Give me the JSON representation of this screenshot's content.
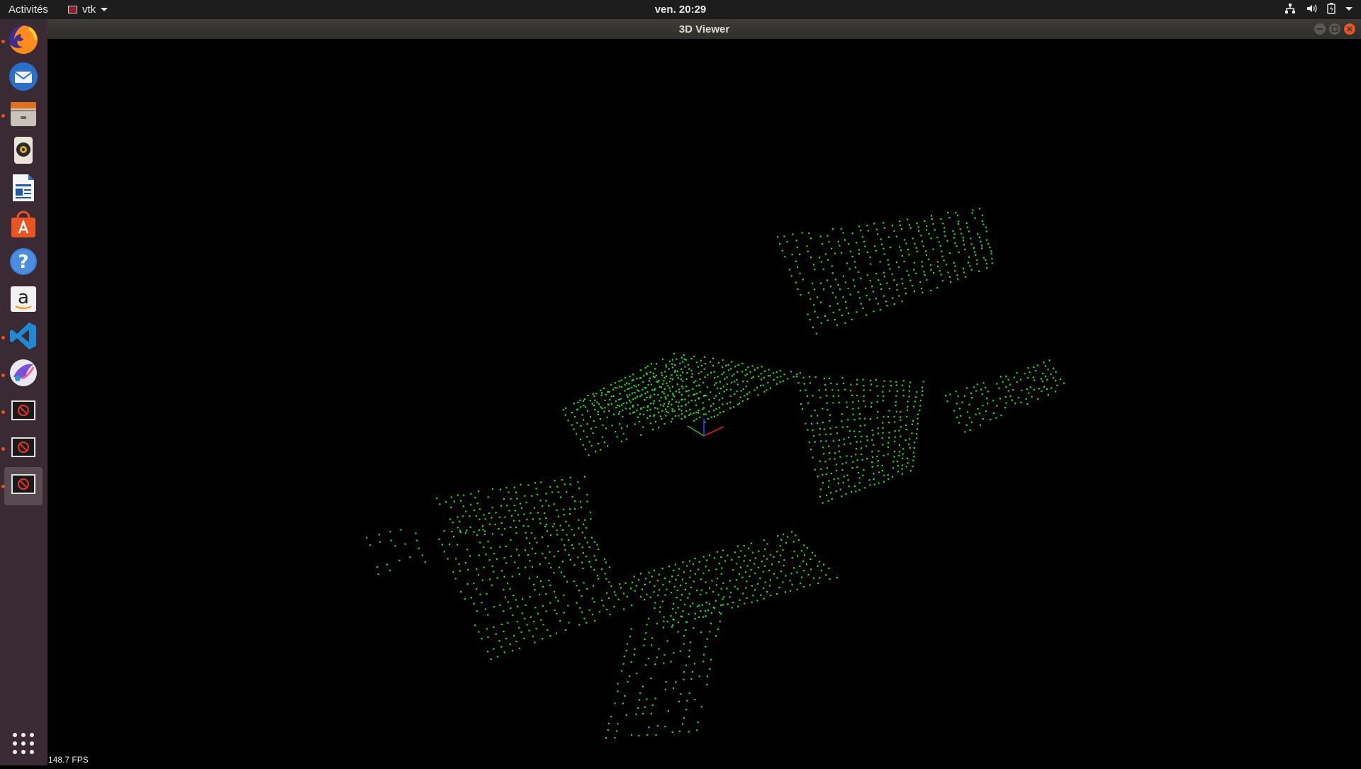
{
  "topbar": {
    "activities": "Activités",
    "app_name": "vtk",
    "clock": "ven. 20:29",
    "tray_icons": [
      "network-icon",
      "volume-icon",
      "battery-icon",
      "system-menu-chevron-icon"
    ]
  },
  "dock": {
    "items": [
      {
        "name": "firefox-icon",
        "running": true
      },
      {
        "name": "thunderbird-icon",
        "running": false
      },
      {
        "name": "files-icon",
        "running": true
      },
      {
        "name": "rhythmbox-icon",
        "running": false
      },
      {
        "name": "libreoffice-writer-icon",
        "running": false
      },
      {
        "name": "software-center-icon",
        "running": false
      },
      {
        "name": "help-icon",
        "running": false
      },
      {
        "name": "amazon-icon",
        "running": false
      },
      {
        "name": "vscode-icon",
        "running": true
      },
      {
        "name": "krita-icon",
        "running": true
      },
      {
        "name": "vtk-window-icon",
        "running": true
      },
      {
        "name": "vtk-window-icon",
        "running": true
      },
      {
        "name": "vtk-window-icon",
        "running": true
      }
    ],
    "show_apps_icon": "grid-icon"
  },
  "window": {
    "title": "3D Viewer",
    "fps": "148.7 FPS",
    "point_color": "#1fe01f"
  },
  "colors": {
    "accent": "#e95420",
    "topbar_bg": "#1d1d1d",
    "dock_bg": "#3a2a33"
  }
}
